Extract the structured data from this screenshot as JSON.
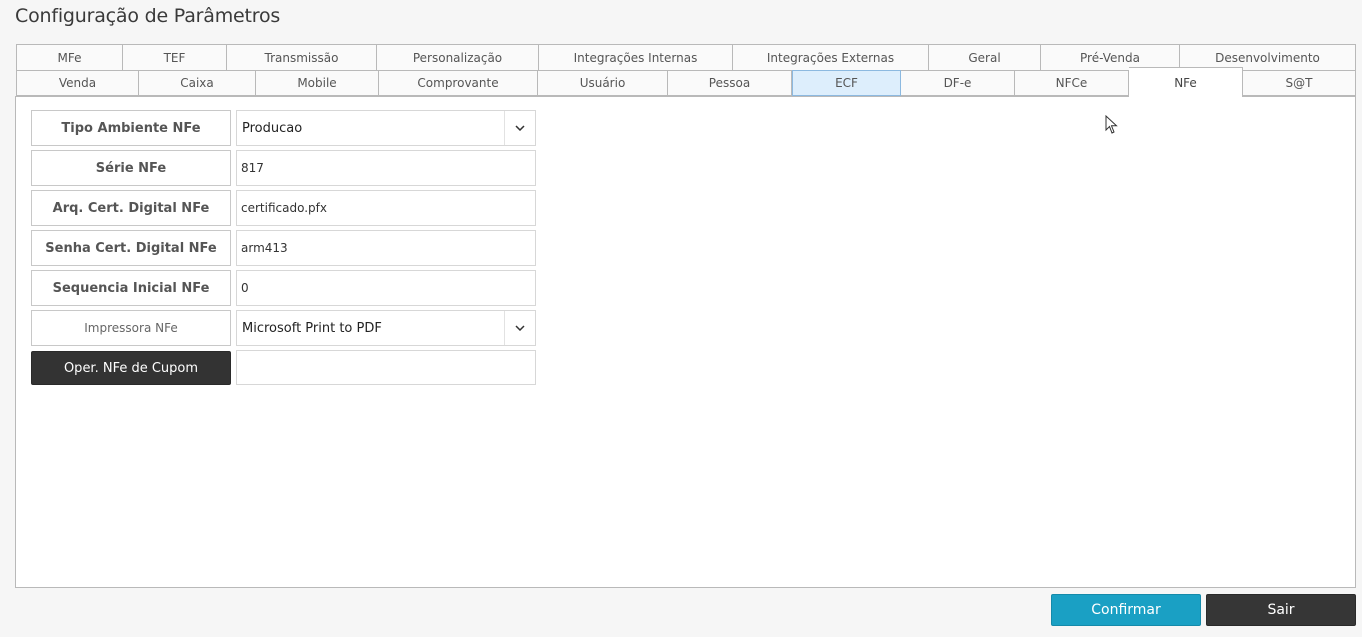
{
  "window": {
    "title": "Configuração de Parâmetros"
  },
  "tabs": {
    "row1": [
      "MFe",
      "TEF",
      "Transmissão",
      "Personalização",
      "Integrações Internas",
      "Integrações Externas",
      "Geral",
      "Pré-Venda",
      "Desenvolvimento"
    ],
    "row2": [
      "Venda",
      "Caixa",
      "Mobile",
      "Comprovante",
      "Usuário",
      "Pessoa",
      "ECF",
      "DF-e",
      "NFCe",
      "NFe",
      "S@T"
    ],
    "active": "NFe",
    "highlighted": "ECF"
  },
  "form": {
    "tipo_ambiente": {
      "label": "Tipo Ambiente NFe",
      "value": "Producao"
    },
    "serie": {
      "label": "Série NFe",
      "value": "817"
    },
    "arq_cert": {
      "label": "Arq. Cert. Digital NFe",
      "value": "certificado.pfx"
    },
    "senha_cert": {
      "label": "Senha Cert. Digital NFe",
      "value": "arm413"
    },
    "sequencia": {
      "label": "Sequencia Inicial NFe",
      "value": "0"
    },
    "impressora": {
      "label": "Impressora NFe",
      "value": "Microsoft Print to PDF"
    },
    "oper_cupom": {
      "label": "Oper. NFe de Cupom",
      "value": ""
    }
  },
  "footer": {
    "confirm_label": "Confirmar",
    "exit_label": "Sair"
  },
  "icons": {
    "dropdown": "chevron-down-icon",
    "cursor": "mouse-pointer-icon"
  },
  "colors": {
    "confirm_button": "#1aa0c4",
    "exit_button": "#363636",
    "highlight_tab": "#ddeefc"
  }
}
